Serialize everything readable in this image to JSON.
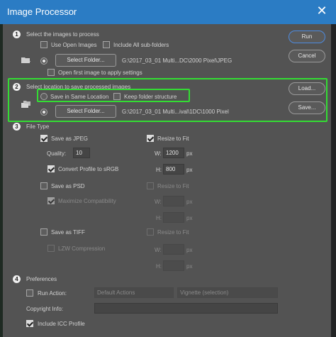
{
  "window": {
    "title": "Image Processor",
    "close_glyph": "✕"
  },
  "section1": {
    "number": "1",
    "heading": "Select the images to process",
    "use_open_images": "Use Open Images",
    "include_subfolders": "Include All sub-folders",
    "select_folder_button": "Select Folder...",
    "folder_path": "G:\\2017_03_01 Multi...DC\\2000 Pixel\\JPEG",
    "open_first_image": "Open first image to apply settings"
  },
  "section2": {
    "number": "2",
    "heading": "Select location to save processed images",
    "save_same_location": "Save in Same Location",
    "keep_folder_structure": "Keep folder structure",
    "select_folder_button": "Select Folder...",
    "folder_path": "G:\\2017_03_01 Multi...ival\\1DC\\1000 Pixel"
  },
  "section3": {
    "number": "3",
    "heading": "File Type",
    "jpeg": {
      "save_label": "Save as JPEG",
      "resize_label": "Resize to Fit",
      "quality_label": "Quality:",
      "quality_value": "10",
      "w_label": "W:",
      "w_value": "1200",
      "h_label": "H:",
      "h_value": "800",
      "unit": "px",
      "convert_profile": "Convert Profile to sRGB"
    },
    "psd": {
      "save_label": "Save as PSD",
      "resize_label": "Resize to Fit",
      "maximize": "Maximize Compatibility",
      "w_label": "W:",
      "h_label": "H:",
      "unit": "px"
    },
    "tiff": {
      "save_label": "Save as TIFF",
      "resize_label": "Resize to Fit",
      "lzw": "LZW Compression",
      "w_label": "W:",
      "h_label": "H:",
      "unit": "px"
    }
  },
  "section4": {
    "number": "4",
    "heading": "Preferences",
    "run_action": "Run Action:",
    "action_set": "Default Actions",
    "action_name": "Vignette (selection)",
    "copyright_label": "Copyright Info:",
    "copyright_value": "",
    "include_icc": "Include ICC Profile"
  },
  "buttons": {
    "run": "Run",
    "cancel": "Cancel",
    "load": "Load...",
    "save": "Save..."
  },
  "colors": {
    "titlebar": "#2b7cc4",
    "highlight": "#33dd33",
    "panel": "#535353"
  }
}
